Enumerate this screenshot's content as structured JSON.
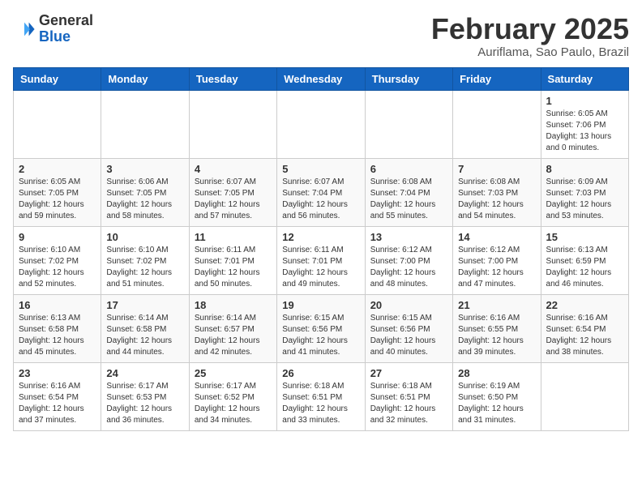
{
  "header": {
    "logo_general": "General",
    "logo_blue": "Blue",
    "month_title": "February 2025",
    "location": "Auriflama, Sao Paulo, Brazil"
  },
  "days_of_week": [
    "Sunday",
    "Monday",
    "Tuesday",
    "Wednesday",
    "Thursday",
    "Friday",
    "Saturday"
  ],
  "weeks": [
    [
      {
        "day": "",
        "info": ""
      },
      {
        "day": "",
        "info": ""
      },
      {
        "day": "",
        "info": ""
      },
      {
        "day": "",
        "info": ""
      },
      {
        "day": "",
        "info": ""
      },
      {
        "day": "",
        "info": ""
      },
      {
        "day": "1",
        "info": "Sunrise: 6:05 AM\nSunset: 7:06 PM\nDaylight: 13 hours and 0 minutes."
      }
    ],
    [
      {
        "day": "2",
        "info": "Sunrise: 6:05 AM\nSunset: 7:05 PM\nDaylight: 12 hours and 59 minutes."
      },
      {
        "day": "3",
        "info": "Sunrise: 6:06 AM\nSunset: 7:05 PM\nDaylight: 12 hours and 58 minutes."
      },
      {
        "day": "4",
        "info": "Sunrise: 6:07 AM\nSunset: 7:05 PM\nDaylight: 12 hours and 57 minutes."
      },
      {
        "day": "5",
        "info": "Sunrise: 6:07 AM\nSunset: 7:04 PM\nDaylight: 12 hours and 56 minutes."
      },
      {
        "day": "6",
        "info": "Sunrise: 6:08 AM\nSunset: 7:04 PM\nDaylight: 12 hours and 55 minutes."
      },
      {
        "day": "7",
        "info": "Sunrise: 6:08 AM\nSunset: 7:03 PM\nDaylight: 12 hours and 54 minutes."
      },
      {
        "day": "8",
        "info": "Sunrise: 6:09 AM\nSunset: 7:03 PM\nDaylight: 12 hours and 53 minutes."
      }
    ],
    [
      {
        "day": "9",
        "info": "Sunrise: 6:10 AM\nSunset: 7:02 PM\nDaylight: 12 hours and 52 minutes."
      },
      {
        "day": "10",
        "info": "Sunrise: 6:10 AM\nSunset: 7:02 PM\nDaylight: 12 hours and 51 minutes."
      },
      {
        "day": "11",
        "info": "Sunrise: 6:11 AM\nSunset: 7:01 PM\nDaylight: 12 hours and 50 minutes."
      },
      {
        "day": "12",
        "info": "Sunrise: 6:11 AM\nSunset: 7:01 PM\nDaylight: 12 hours and 49 minutes."
      },
      {
        "day": "13",
        "info": "Sunrise: 6:12 AM\nSunset: 7:00 PM\nDaylight: 12 hours and 48 minutes."
      },
      {
        "day": "14",
        "info": "Sunrise: 6:12 AM\nSunset: 7:00 PM\nDaylight: 12 hours and 47 minutes."
      },
      {
        "day": "15",
        "info": "Sunrise: 6:13 AM\nSunset: 6:59 PM\nDaylight: 12 hours and 46 minutes."
      }
    ],
    [
      {
        "day": "16",
        "info": "Sunrise: 6:13 AM\nSunset: 6:58 PM\nDaylight: 12 hours and 45 minutes."
      },
      {
        "day": "17",
        "info": "Sunrise: 6:14 AM\nSunset: 6:58 PM\nDaylight: 12 hours and 44 minutes."
      },
      {
        "day": "18",
        "info": "Sunrise: 6:14 AM\nSunset: 6:57 PM\nDaylight: 12 hours and 42 minutes."
      },
      {
        "day": "19",
        "info": "Sunrise: 6:15 AM\nSunset: 6:56 PM\nDaylight: 12 hours and 41 minutes."
      },
      {
        "day": "20",
        "info": "Sunrise: 6:15 AM\nSunset: 6:56 PM\nDaylight: 12 hours and 40 minutes."
      },
      {
        "day": "21",
        "info": "Sunrise: 6:16 AM\nSunset: 6:55 PM\nDaylight: 12 hours and 39 minutes."
      },
      {
        "day": "22",
        "info": "Sunrise: 6:16 AM\nSunset: 6:54 PM\nDaylight: 12 hours and 38 minutes."
      }
    ],
    [
      {
        "day": "23",
        "info": "Sunrise: 6:16 AM\nSunset: 6:54 PM\nDaylight: 12 hours and 37 minutes."
      },
      {
        "day": "24",
        "info": "Sunrise: 6:17 AM\nSunset: 6:53 PM\nDaylight: 12 hours and 36 minutes."
      },
      {
        "day": "25",
        "info": "Sunrise: 6:17 AM\nSunset: 6:52 PM\nDaylight: 12 hours and 34 minutes."
      },
      {
        "day": "26",
        "info": "Sunrise: 6:18 AM\nSunset: 6:51 PM\nDaylight: 12 hours and 33 minutes."
      },
      {
        "day": "27",
        "info": "Sunrise: 6:18 AM\nSunset: 6:51 PM\nDaylight: 12 hours and 32 minutes."
      },
      {
        "day": "28",
        "info": "Sunrise: 6:19 AM\nSunset: 6:50 PM\nDaylight: 12 hours and 31 minutes."
      },
      {
        "day": "",
        "info": ""
      }
    ]
  ]
}
